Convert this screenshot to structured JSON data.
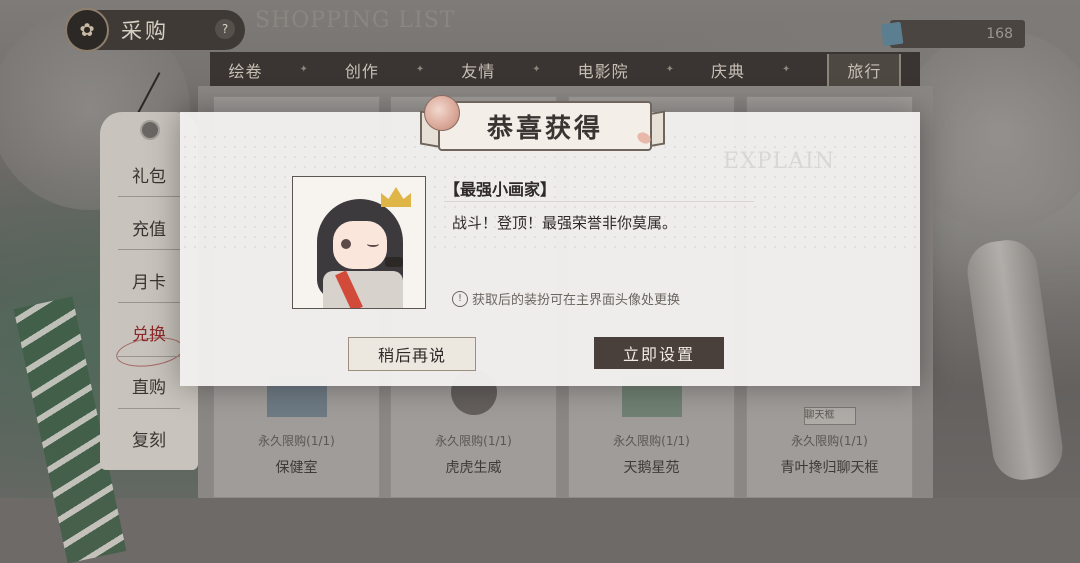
{
  "header": {
    "title": "采购",
    "subtitle_decor": "SHOPPING LIST",
    "currency_amount": "168"
  },
  "categories": [
    {
      "label": "绘卷",
      "active": false
    },
    {
      "label": "创作",
      "active": false
    },
    {
      "label": "友情",
      "active": false
    },
    {
      "label": "电影院",
      "active": false
    },
    {
      "label": "庆典",
      "active": false
    },
    {
      "label": "旅行",
      "active": true
    }
  ],
  "sidebar": {
    "items": [
      {
        "label": "礼包",
        "active": false
      },
      {
        "label": "充值",
        "active": false
      },
      {
        "label": "月卡",
        "active": false
      },
      {
        "label": "兑换",
        "active": true
      },
      {
        "label": "直购",
        "active": false
      },
      {
        "label": "复刻",
        "active": false
      }
    ]
  },
  "cards": [
    {
      "limit": "永久限购(1/1)",
      "name": "保健室"
    },
    {
      "limit": "永久限购(1/1)",
      "name": "虎虎生威"
    },
    {
      "limit": "永久限购(1/1)",
      "name": "天鹅星苑"
    },
    {
      "limit": "永久限购(1/1)",
      "name": "青叶搀归聊天框",
      "tag": "聊天框"
    }
  ],
  "modal": {
    "title": "恭喜获得",
    "background_word": "EXPLAIN",
    "reward_name": "【最强小画家】",
    "reward_desc": "战斗！登顶！最强荣誉非你莫属。",
    "note": "获取后的装扮可在主界面头像处更换",
    "btn_later": "稍后再说",
    "btn_set": "立即设置"
  },
  "colors": {
    "modal_bg": "#f1f0ee",
    "primary_button": "#4a403b",
    "active_sidebar": "#8c2a2a"
  }
}
